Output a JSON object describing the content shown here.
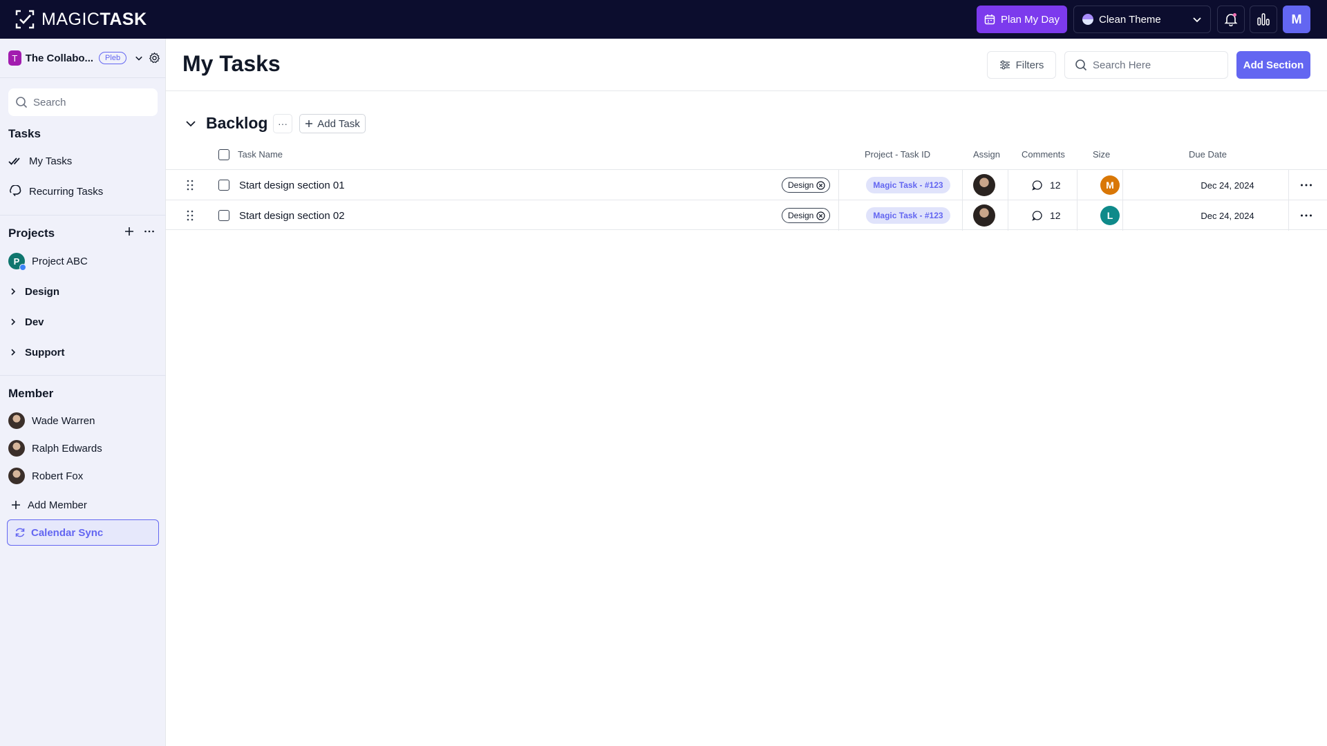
{
  "app": {
    "logo_text_regular": "MAGIC",
    "logo_text_bold": "TASK"
  },
  "topbar": {
    "plan_label": "Plan My Day",
    "theme_label": "Clean Theme",
    "user_initial": "M"
  },
  "sidebar": {
    "workspace_initial": "T",
    "workspace_name": "The Collabo...",
    "plan_badge": "Pleb",
    "search_placeholder": "Search",
    "tasks_title": "Tasks",
    "task_items": [
      {
        "label": "My Tasks",
        "icon": "double-check-icon"
      },
      {
        "label": "Recurring Tasks",
        "icon": "repeat-icon"
      }
    ],
    "projects_title": "Projects",
    "project_avatar_initial": "P",
    "project_name": "Project ABC",
    "project_groups": [
      "Design",
      "Dev",
      "Support"
    ],
    "member_title": "Member",
    "members": [
      "Wade Warren",
      "Ralph Edwards",
      "Robert Fox"
    ],
    "add_member_label": "Add Member",
    "calendar_sync_label": "Calendar Sync"
  },
  "main": {
    "title": "My Tasks",
    "filters_label": "Filters",
    "search_placeholder": "Search Here",
    "add_section_label": "Add Section",
    "section": {
      "title": "Backlog",
      "more_label": "···",
      "add_task_label": "Add Task"
    },
    "columns": {
      "task_name": "Task Name",
      "project_task_id": "Project - Task ID",
      "assign": "Assign",
      "comments": "Comments",
      "size": "Size",
      "due_date": "Due Date"
    },
    "rows": [
      {
        "name": "Start design section 01",
        "tag": "Design",
        "project_task_id": "Magic Task - #123",
        "comments": "12",
        "size_initial": "M",
        "size_color": "#d97706",
        "due_date": "Dec 24, 2024"
      },
      {
        "name": "Start design section 02",
        "tag": "Design",
        "project_task_id": "Magic Task - #123",
        "comments": "12",
        "size_initial": "L",
        "size_color": "#0f8a8a",
        "due_date": "Dec 24, 2024"
      }
    ]
  },
  "colors": {
    "topbar_bg": "#0c0d2e",
    "accent": "#6366f1",
    "plan_button": "#7c3aed",
    "sidebar_bg": "#f0f1fa"
  }
}
